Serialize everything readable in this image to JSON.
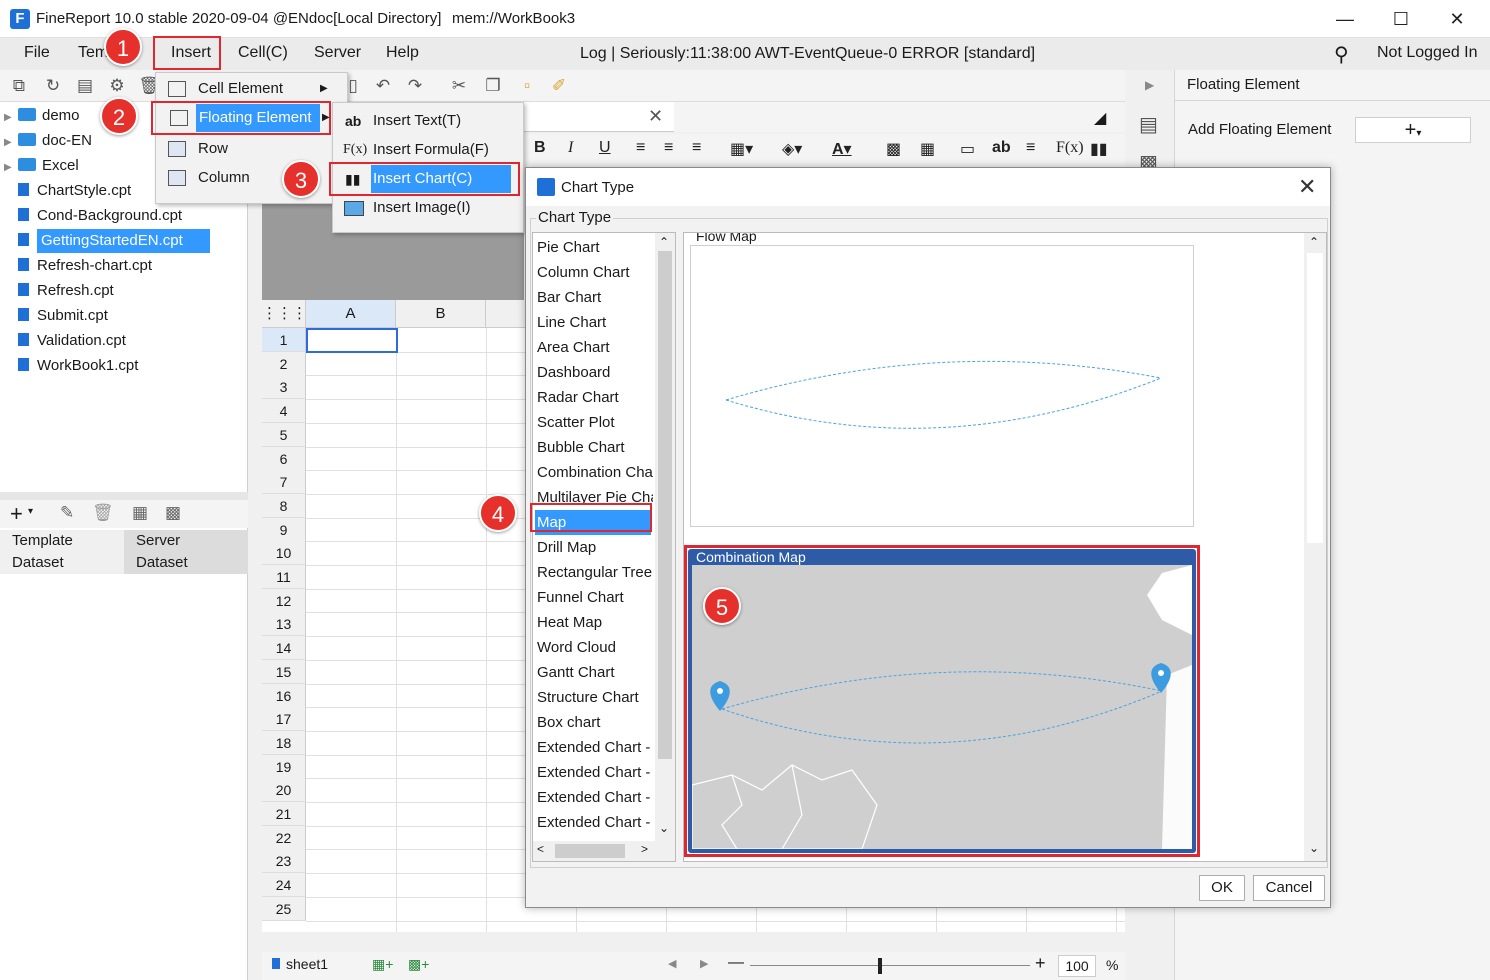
{
  "window": {
    "title": "FineReport 10.0 stable 2020-09-04 @ENdoc[Local Directory]",
    "path": "mem://WorkBook3",
    "controls": [
      "—",
      "☐",
      "✕"
    ]
  },
  "menubar": {
    "items": [
      "File",
      "Tem",
      "Insert",
      "Cell(C)",
      "Server",
      "Help"
    ],
    "log": "Log | Seriously:11:38:00 AWT-EventQueue-0 ERROR [standard]",
    "login": "Not Logged In"
  },
  "tree": {
    "folders": [
      "demo",
      "doc-EN",
      "Excel"
    ],
    "files": [
      "ChartStyle.cpt",
      "Cond-Background.cpt",
      "GettingStartedEN.cpt",
      "Refresh-chart.cpt",
      "Refresh.cpt",
      "Submit.cpt",
      "Validation.cpt",
      "WorkBook1.cpt"
    ],
    "selected": "GettingStartedEN.cpt"
  },
  "lefttabs": {
    "template_dataset": "Template\nDataset",
    "server_dataset": "Server\nDataset"
  },
  "insert_menu": {
    "items": [
      "Cell Element",
      "Floating Element",
      "Row",
      "Column"
    ]
  },
  "floating_submenu": {
    "items": [
      "Insert Text(T)",
      "Insert Formula(F)",
      "Insert Chart(C)",
      "Insert Image(I)"
    ]
  },
  "sheet": {
    "columns": [
      "A",
      "B"
    ],
    "rows": [
      "1",
      "2",
      "3",
      "4",
      "5",
      "6",
      "7",
      "8",
      "9",
      "10",
      "11",
      "12",
      "13",
      "14",
      "15",
      "16",
      "17",
      "18",
      "19",
      "20",
      "21",
      "22",
      "23",
      "24",
      "25"
    ],
    "tab": "sheet1",
    "zoom": "100",
    "zoom_unit": "%"
  },
  "right_panel": {
    "title": "Floating Element",
    "add_label": "Add Floating Element"
  },
  "dialog": {
    "title": "Chart Type",
    "group_label": "Chart Type",
    "chart_types": [
      "Pie Chart",
      "Column Chart",
      "Bar Chart",
      "Line Chart",
      "Area Chart",
      "Dashboard",
      "Radar Chart",
      "Scatter Plot",
      "Bubble Chart",
      "Combination Cha",
      "Multilayer Pie Cha",
      "Map",
      "Drill Map",
      "Rectangular Tree",
      "Funnel Chart",
      "Heat Map",
      "Word Cloud",
      "Gantt Chart",
      "Structure Chart",
      "Box chart",
      "Extended Chart -",
      "Extended Chart -",
      "Extended Chart -",
      "Extended Chart -"
    ],
    "selected_type": "Map",
    "preview_1": "Flow Map",
    "preview_2": "Combination Map",
    "ok": "OK",
    "cancel": "Cancel"
  },
  "badges": [
    "1",
    "2",
    "3",
    "4",
    "5"
  ],
  "colors": {
    "highlight": "#3399ff",
    "annotation_red": "#e5302b",
    "map_selected": "#2d5ba8"
  }
}
